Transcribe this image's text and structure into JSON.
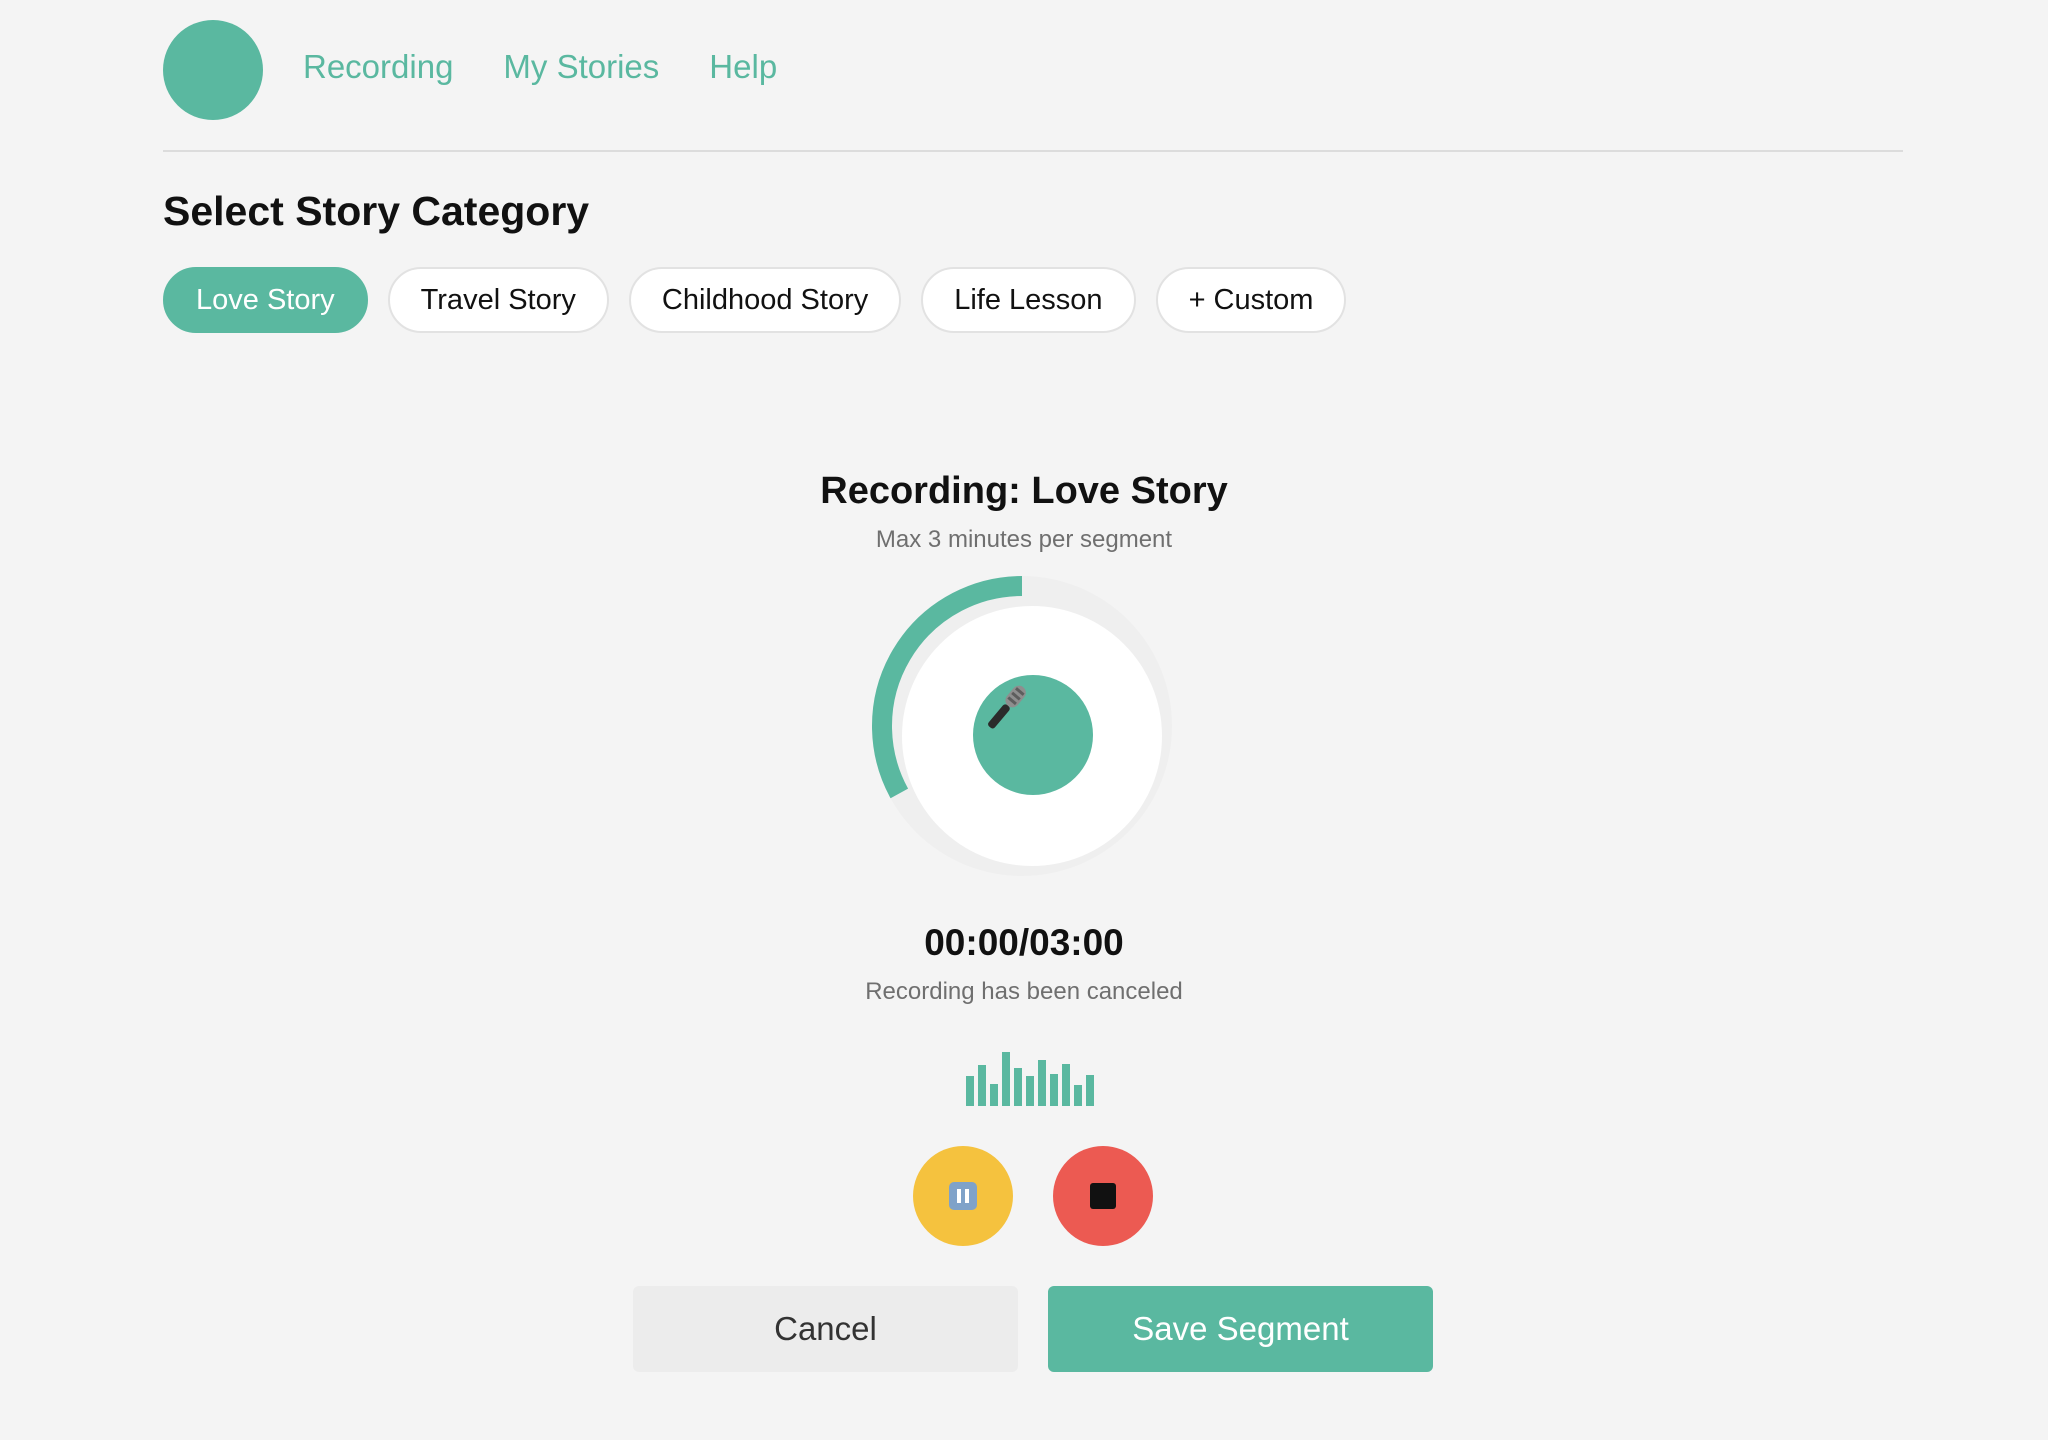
{
  "nav": {
    "items": [
      {
        "label": "Recording"
      },
      {
        "label": "My Stories"
      },
      {
        "label": "Help"
      }
    ]
  },
  "category": {
    "title": "Select Story Category",
    "chips": [
      {
        "label": "Love Story",
        "selected": true
      },
      {
        "label": "Travel Story",
        "selected": false
      },
      {
        "label": "Childhood Story",
        "selected": false
      },
      {
        "label": "Life Lesson",
        "selected": false
      },
      {
        "label": "+ Custom",
        "selected": false
      }
    ]
  },
  "recording": {
    "title": "Recording: Love Story",
    "subtitle": "Max 3 minutes per segment",
    "progress_fraction": 0.33,
    "timer": "00:00/03:00",
    "status": "Recording has been canceled",
    "waveform_levels": [
      0.55,
      0.75,
      0.4,
      1.0,
      0.7,
      0.55,
      0.85,
      0.6,
      0.78,
      0.38,
      0.58
    ]
  },
  "controls": {
    "pause_icon": "pause-icon",
    "stop_icon": "stop-icon",
    "mic_icon": "microphone-icon"
  },
  "actions": {
    "cancel_label": "Cancel",
    "save_label": "Save Segment"
  },
  "colors": {
    "accent": "#5ab8a0",
    "pause": "#f5c23e",
    "stop": "#ec5a52",
    "background": "#f4f4f4"
  }
}
